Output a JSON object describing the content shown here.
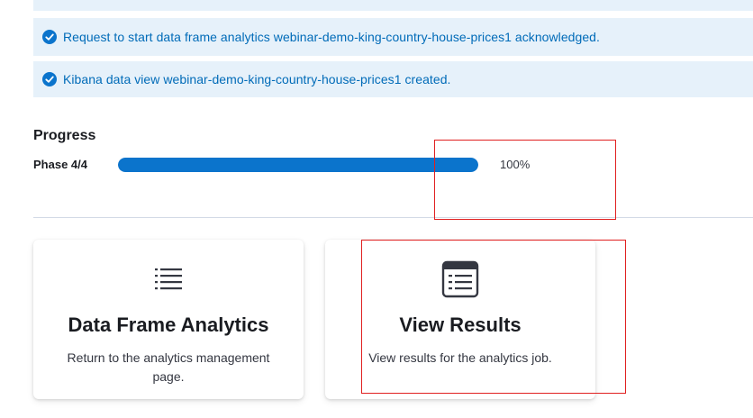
{
  "callouts": [
    {
      "text": "Request to start data frame analytics webinar-demo-king-country-house-prices1 acknowledged."
    },
    {
      "text": "Kibana data view webinar-demo-king-country-house-prices1 created."
    }
  ],
  "progress": {
    "title": "Progress",
    "phase_label": "Phase 4/4",
    "value_text": "100%",
    "value_fraction": 1.0,
    "fill_color": "#0b74cc"
  },
  "cards": [
    {
      "icon": "list-icon",
      "title": "Data Frame Analytics",
      "description": "Return to the analytics management page."
    },
    {
      "icon": "table-icon",
      "title": "View Results",
      "description": "View results for the analytics job."
    }
  ],
  "colors": {
    "callout_background": "#e6f1fa",
    "callout_text": "#006bb8",
    "annotation_border": "#e02020"
  }
}
